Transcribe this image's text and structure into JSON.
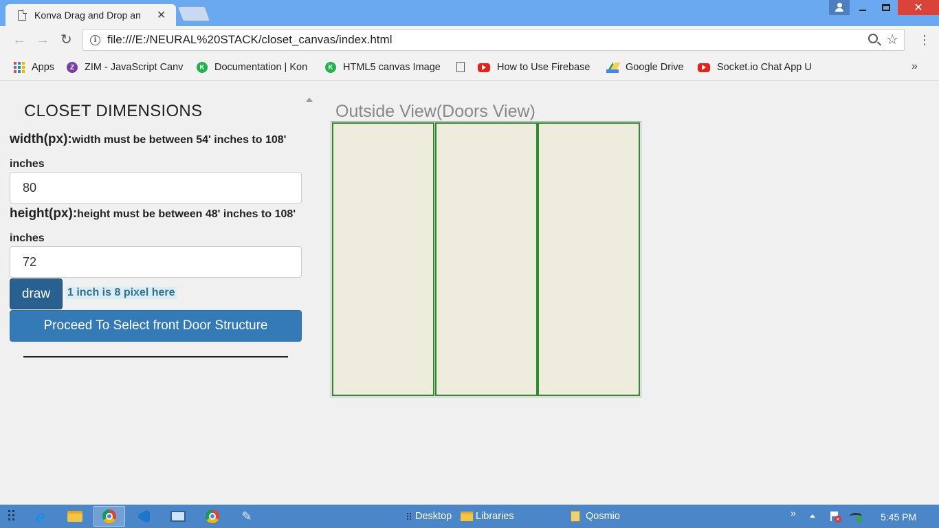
{
  "browser": {
    "tab_title": "Konva Drag and Drop an",
    "tab_close": "✕",
    "url": "file:///E:/NEURAL%20STACK/closet_canvas/index.html",
    "window_close": "✕",
    "bookmarks": [
      {
        "label": "Apps",
        "icon": "apps-grid-icon"
      },
      {
        "label": "ZIM - JavaScript Canv",
        "icon": "zim-icon",
        "glyph": "Z"
      },
      {
        "label": "Documentation | Kon",
        "icon": "konva-icon",
        "glyph": "K"
      },
      {
        "label": "HTML5 canvas Image",
        "icon": "konva-icon",
        "glyph": "K"
      },
      {
        "label": "How to Use Firebase",
        "icon": "page-icon"
      },
      {
        "label": "Google Drive",
        "icon": "youtube-icon"
      },
      {
        "label": "Socket.io Chat App U",
        "icon": "google-drive-icon"
      },
      {
        "label": "",
        "icon": "youtube-icon"
      }
    ],
    "bookmarks_more": "»"
  },
  "page": {
    "heading": "CLOSET DIMENSIONS",
    "width_label": "width(px):",
    "width_hint": "width must be between 54' inches to 108' inches",
    "width_value": "80",
    "height_label": "height(px):",
    "height_hint": "height must be between 48' inches to 108' inches",
    "height_value": "72",
    "draw_button": "draw",
    "scale_note": "1 inch is 8 pixel here",
    "proceed_button": "Proceed To Select front Door Structure",
    "canvas_title": "Outside View(Doors View)",
    "door_count": 3,
    "colors": {
      "door_fill": "#edecdd",
      "door_stroke": "#2e8b2e",
      "primary_button": "#337ab7",
      "draw_button": "#286090"
    }
  },
  "taskbar": {
    "desktop_label": "Desktop",
    "libraries_label": "Libraries",
    "qosmio_label": "Qosmio",
    "chevrons": "»",
    "clock": "5:45 PM"
  }
}
